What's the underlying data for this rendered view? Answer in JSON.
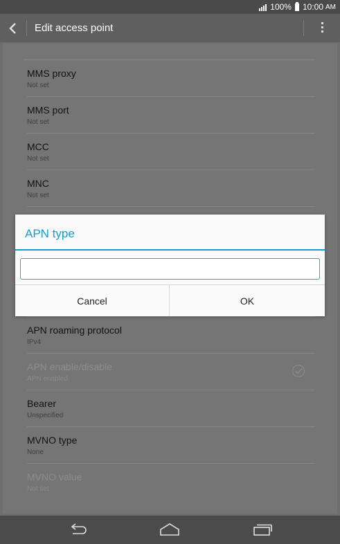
{
  "status_bar": {
    "battery": "100%",
    "time": "10:00",
    "ampm": "AM"
  },
  "action_bar": {
    "title": "Edit access point"
  },
  "list": {
    "items": [
      {
        "title": "MMS proxy",
        "subtitle": "Not set"
      },
      {
        "title": "MMS port",
        "subtitle": "Not set"
      },
      {
        "title": "MCC",
        "subtitle": "Not set"
      },
      {
        "title": "MNC",
        "subtitle": "Not set"
      },
      {
        "title": "APN roaming protocol",
        "subtitle": "IPv4"
      },
      {
        "title": "APN enable/disable",
        "subtitle": "APN enabled",
        "disabled": true,
        "checked": true
      },
      {
        "title": "Bearer",
        "subtitle": "Unspecified"
      },
      {
        "title": "MVNO type",
        "subtitle": "None"
      },
      {
        "title": "MVNO value",
        "subtitle": "Not set",
        "disabled": true
      }
    ]
  },
  "dialog": {
    "title": "APN type",
    "input_value": "",
    "cancel_label": "Cancel",
    "ok_label": "OK"
  },
  "colors": {
    "accent": "#1a9bcb"
  },
  "icons": [
    "signal-icon",
    "battery-icon",
    "back-icon",
    "overflow-menu-icon",
    "checkmark-icon",
    "nav-back-icon",
    "nav-home-icon",
    "nav-recents-icon"
  ]
}
